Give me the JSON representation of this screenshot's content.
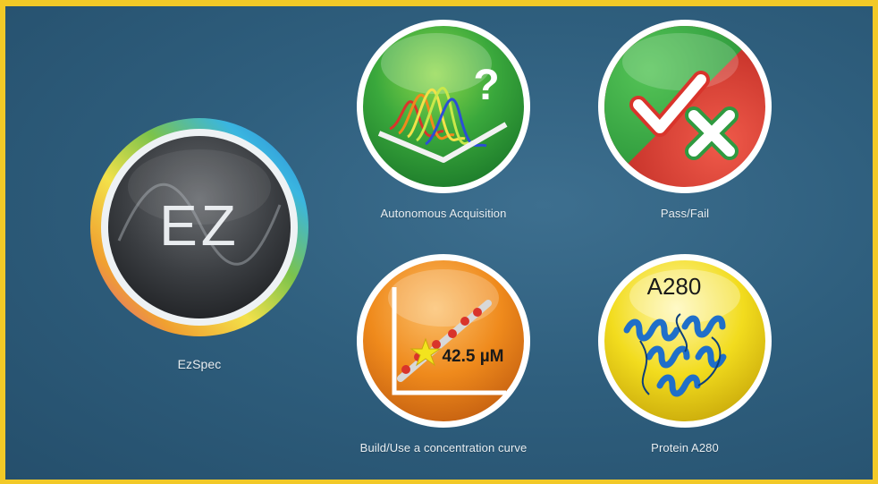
{
  "apps": {
    "ezspec": {
      "label": "EzSpec",
      "logo_text": "EZ"
    },
    "autonomous": {
      "label": "Autonomous Acquisition",
      "glyph": "?"
    },
    "passfail": {
      "label": "Pass/Fail"
    },
    "concentration": {
      "label": "Build/Use a concentration curve",
      "readout": "42.5 µM"
    },
    "protein": {
      "label": "Protein A280",
      "title": "A280"
    }
  },
  "colors": {
    "background": "#2f5f7e",
    "frame": "#f2c927",
    "green": "#3aa83c",
    "red": "#d9342b",
    "orange": "#ef8a1c",
    "yellow": "#f2dc1e",
    "protein_blue": "#1f6fc9"
  }
}
